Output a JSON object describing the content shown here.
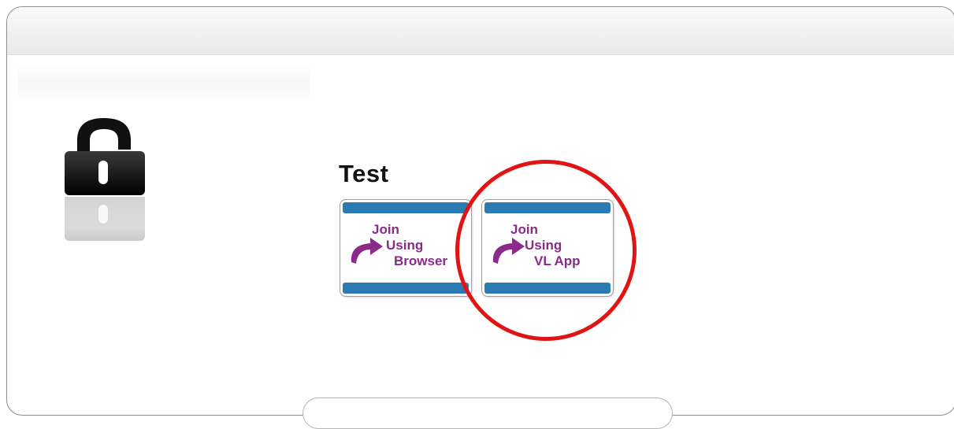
{
  "meeting": {
    "title": "Test"
  },
  "join_browser": {
    "line1": "Join",
    "line2": "Using",
    "line3": "Browser",
    "icon": "curved-arrow-icon"
  },
  "join_app": {
    "line1": "Join",
    "line2": "Using",
    "line3": "VL App",
    "icon": "curved-arrow-icon"
  },
  "icons": {
    "lock": "lock-icon"
  },
  "colors": {
    "button_bar": "#2b7ab3",
    "button_text": "#8a2a8a",
    "annotation_circle": "#e11414"
  }
}
